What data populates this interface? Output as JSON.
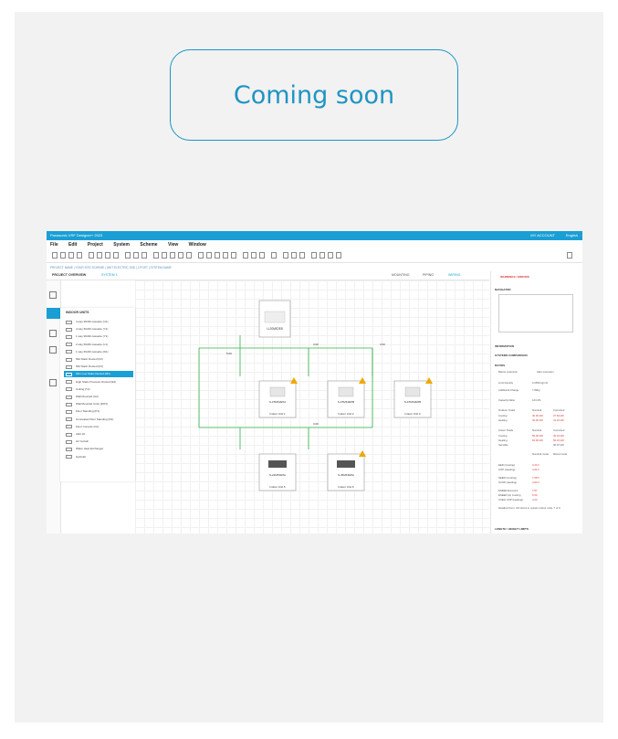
{
  "banner": {
    "text": "Coming soon"
  },
  "app": {
    "title": "Panasonic VRF Designer+ 2023",
    "account": "MY ACCOUNT",
    "language": "English",
    "menu": [
      "File",
      "Edit",
      "Project",
      "System",
      "Scheme",
      "View",
      "Window"
    ],
    "breadcrumb": "PROJECT NAME | YOUR SITE SCHEME | UNIT ELECTRIC 2ND | 1.POST | SYSTEM NAME",
    "tab_overview": "PROJECT OVERVIEW",
    "tab_system": "SYSTEM 1",
    "modes": [
      "MOUNTING",
      "PIPING",
      "WIRING"
    ],
    "units_header": "INDOOR UNITS",
    "units": [
      "4 way 90x90 cassette (U1)",
      "4 way 60x60 cassette (Y1)",
      "1 way 90x90 cassette (Y1)",
      "2 way 60x60 cassette (L1)",
      "1 way 60x60 cassette (D1)",
      "Mid Static Ducted (F2)",
      "Mid Static Ducted (F3)",
      "Slim Low Static Ducted (M1)",
      "High Static Pressure Ducted (E2)",
      "Ceiling (T2)",
      "Wall Mounted (K2)",
      "Wall Mounted Units (DOV)",
      "Floor Standing (P1)",
      "Concealed Floor Standing (R1)",
      "Floor Console (G1)",
      "AHU kit",
      "Air Curtain",
      "Water Heat Exchanger",
      "Hydrokit"
    ],
    "outdoor": {
      "model": "U-20ME2E8",
      "ports": [
        "DT",
        "HA"
      ]
    },
    "pipe_lengths": [
      "5.00",
      "3.00",
      "3.00",
      "3.00"
    ],
    "pipe_label_mid": "0.00",
    "indoor_units": [
      {
        "model": "S-15MK2E5A",
        "name": "Indoor Unit 1"
      },
      {
        "model": "S-15MK2E5B",
        "name": "Indoor Unit 2"
      },
      {
        "model": "S-15MK2E5B",
        "name": "Indoor Unit 3"
      },
      {
        "model": "S-22MF3E5A",
        "name": "Indoor Unit 5"
      },
      {
        "model": "S-36MF3E5A",
        "name": "Indoor Unit 6"
      }
    ],
    "right": {
      "warnings": "WARNINGS / ERRORS",
      "navigator": "NAVIGATOR",
      "information": "INFORMATION",
      "system_comparison": "SYSTEMS COMPARISON",
      "ratios": "RATIOS",
      "before_extension": "Before extension",
      "after_extension": "After extension",
      "limit_density": "Limit Density",
      "limit_density_val": "0.2650 kg/m3",
      "add_charge": "Additional Charge",
      "add_charge_val": "7.89kg",
      "capacity_ratio": "Capacity Ratio",
      "capacity_ratio_val": "124.4%",
      "outdoor_totals": "Outdoor Totals",
      "indoor_totals": "Indoor Totals",
      "cols": [
        "Nominal",
        "Corrected"
      ],
      "rows_out": [
        [
          "Cooling",
          "40.00 kW",
          "37.84 kW"
        ],
        [
          "Heating",
          "45.00 kW",
          "41.22 kW"
        ]
      ],
      "rows_in": [
        [
          "Cooling",
          "56.00 kW",
          "46.34 kW"
        ],
        [
          "Heating",
          "63.00 kW",
          "56.22 kW"
        ],
        [
          "Sensible",
          "",
          "36.97 kW"
        ]
      ],
      "modes2": [
        "Nominal mode",
        "Mixed mode"
      ],
      "eer": [
        [
          "EER (Cooling)",
          "4.24 h"
        ],
        [
          "COP (Heating)",
          "4.64 h"
        ]
      ],
      "seer": [
        [
          "SEER (Cooling)",
          "7.08 h"
        ],
        [
          "SCOP (Heating)",
          "4.54 h"
        ]
      ],
      "sepr": [
        [
          "ESEER Eurovent",
          "7.87"
        ],
        [
          "ESEER (H) Cooling",
          "5.60"
        ],
        [
          "UVEG COP (Heating)",
          "4.23"
        ]
      ],
      "note": "Detailed From: 4/4 Hours in system indoor units: 7 of 9",
      "length_limits": "LENGTH / HEIGHT LIMITS"
    }
  }
}
